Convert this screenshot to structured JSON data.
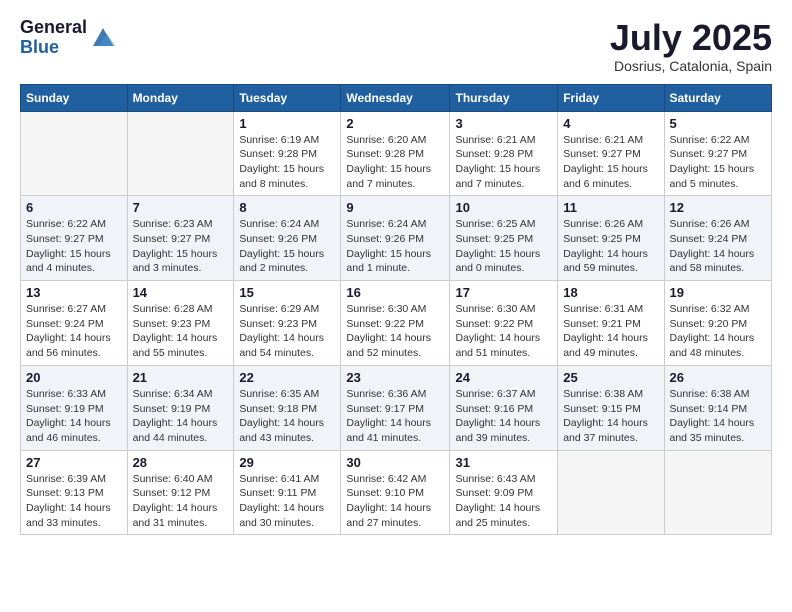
{
  "header": {
    "logo_general": "General",
    "logo_blue": "Blue",
    "month_title": "July 2025",
    "location": "Dosrius, Catalonia, Spain"
  },
  "weekdays": [
    "Sunday",
    "Monday",
    "Tuesday",
    "Wednesday",
    "Thursday",
    "Friday",
    "Saturday"
  ],
  "weeks": [
    [
      {
        "day": "",
        "info": ""
      },
      {
        "day": "",
        "info": ""
      },
      {
        "day": "1",
        "info": "Sunrise: 6:19 AM\nSunset: 9:28 PM\nDaylight: 15 hours\nand 8 minutes."
      },
      {
        "day": "2",
        "info": "Sunrise: 6:20 AM\nSunset: 9:28 PM\nDaylight: 15 hours\nand 7 minutes."
      },
      {
        "day": "3",
        "info": "Sunrise: 6:21 AM\nSunset: 9:28 PM\nDaylight: 15 hours\nand 7 minutes."
      },
      {
        "day": "4",
        "info": "Sunrise: 6:21 AM\nSunset: 9:27 PM\nDaylight: 15 hours\nand 6 minutes."
      },
      {
        "day": "5",
        "info": "Sunrise: 6:22 AM\nSunset: 9:27 PM\nDaylight: 15 hours\nand 5 minutes."
      }
    ],
    [
      {
        "day": "6",
        "info": "Sunrise: 6:22 AM\nSunset: 9:27 PM\nDaylight: 15 hours\nand 4 minutes."
      },
      {
        "day": "7",
        "info": "Sunrise: 6:23 AM\nSunset: 9:27 PM\nDaylight: 15 hours\nand 3 minutes."
      },
      {
        "day": "8",
        "info": "Sunrise: 6:24 AM\nSunset: 9:26 PM\nDaylight: 15 hours\nand 2 minutes."
      },
      {
        "day": "9",
        "info": "Sunrise: 6:24 AM\nSunset: 9:26 PM\nDaylight: 15 hours\nand 1 minute."
      },
      {
        "day": "10",
        "info": "Sunrise: 6:25 AM\nSunset: 9:25 PM\nDaylight: 15 hours\nand 0 minutes."
      },
      {
        "day": "11",
        "info": "Sunrise: 6:26 AM\nSunset: 9:25 PM\nDaylight: 14 hours\nand 59 minutes."
      },
      {
        "day": "12",
        "info": "Sunrise: 6:26 AM\nSunset: 9:24 PM\nDaylight: 14 hours\nand 58 minutes."
      }
    ],
    [
      {
        "day": "13",
        "info": "Sunrise: 6:27 AM\nSunset: 9:24 PM\nDaylight: 14 hours\nand 56 minutes."
      },
      {
        "day": "14",
        "info": "Sunrise: 6:28 AM\nSunset: 9:23 PM\nDaylight: 14 hours\nand 55 minutes."
      },
      {
        "day": "15",
        "info": "Sunrise: 6:29 AM\nSunset: 9:23 PM\nDaylight: 14 hours\nand 54 minutes."
      },
      {
        "day": "16",
        "info": "Sunrise: 6:30 AM\nSunset: 9:22 PM\nDaylight: 14 hours\nand 52 minutes."
      },
      {
        "day": "17",
        "info": "Sunrise: 6:30 AM\nSunset: 9:22 PM\nDaylight: 14 hours\nand 51 minutes."
      },
      {
        "day": "18",
        "info": "Sunrise: 6:31 AM\nSunset: 9:21 PM\nDaylight: 14 hours\nand 49 minutes."
      },
      {
        "day": "19",
        "info": "Sunrise: 6:32 AM\nSunset: 9:20 PM\nDaylight: 14 hours\nand 48 minutes."
      }
    ],
    [
      {
        "day": "20",
        "info": "Sunrise: 6:33 AM\nSunset: 9:19 PM\nDaylight: 14 hours\nand 46 minutes."
      },
      {
        "day": "21",
        "info": "Sunrise: 6:34 AM\nSunset: 9:19 PM\nDaylight: 14 hours\nand 44 minutes."
      },
      {
        "day": "22",
        "info": "Sunrise: 6:35 AM\nSunset: 9:18 PM\nDaylight: 14 hours\nand 43 minutes."
      },
      {
        "day": "23",
        "info": "Sunrise: 6:36 AM\nSunset: 9:17 PM\nDaylight: 14 hours\nand 41 minutes."
      },
      {
        "day": "24",
        "info": "Sunrise: 6:37 AM\nSunset: 9:16 PM\nDaylight: 14 hours\nand 39 minutes."
      },
      {
        "day": "25",
        "info": "Sunrise: 6:38 AM\nSunset: 9:15 PM\nDaylight: 14 hours\nand 37 minutes."
      },
      {
        "day": "26",
        "info": "Sunrise: 6:38 AM\nSunset: 9:14 PM\nDaylight: 14 hours\nand 35 minutes."
      }
    ],
    [
      {
        "day": "27",
        "info": "Sunrise: 6:39 AM\nSunset: 9:13 PM\nDaylight: 14 hours\nand 33 minutes."
      },
      {
        "day": "28",
        "info": "Sunrise: 6:40 AM\nSunset: 9:12 PM\nDaylight: 14 hours\nand 31 minutes."
      },
      {
        "day": "29",
        "info": "Sunrise: 6:41 AM\nSunset: 9:11 PM\nDaylight: 14 hours\nand 30 minutes."
      },
      {
        "day": "30",
        "info": "Sunrise: 6:42 AM\nSunset: 9:10 PM\nDaylight: 14 hours\nand 27 minutes."
      },
      {
        "day": "31",
        "info": "Sunrise: 6:43 AM\nSunset: 9:09 PM\nDaylight: 14 hours\nand 25 minutes."
      },
      {
        "day": "",
        "info": ""
      },
      {
        "day": "",
        "info": ""
      }
    ]
  ]
}
